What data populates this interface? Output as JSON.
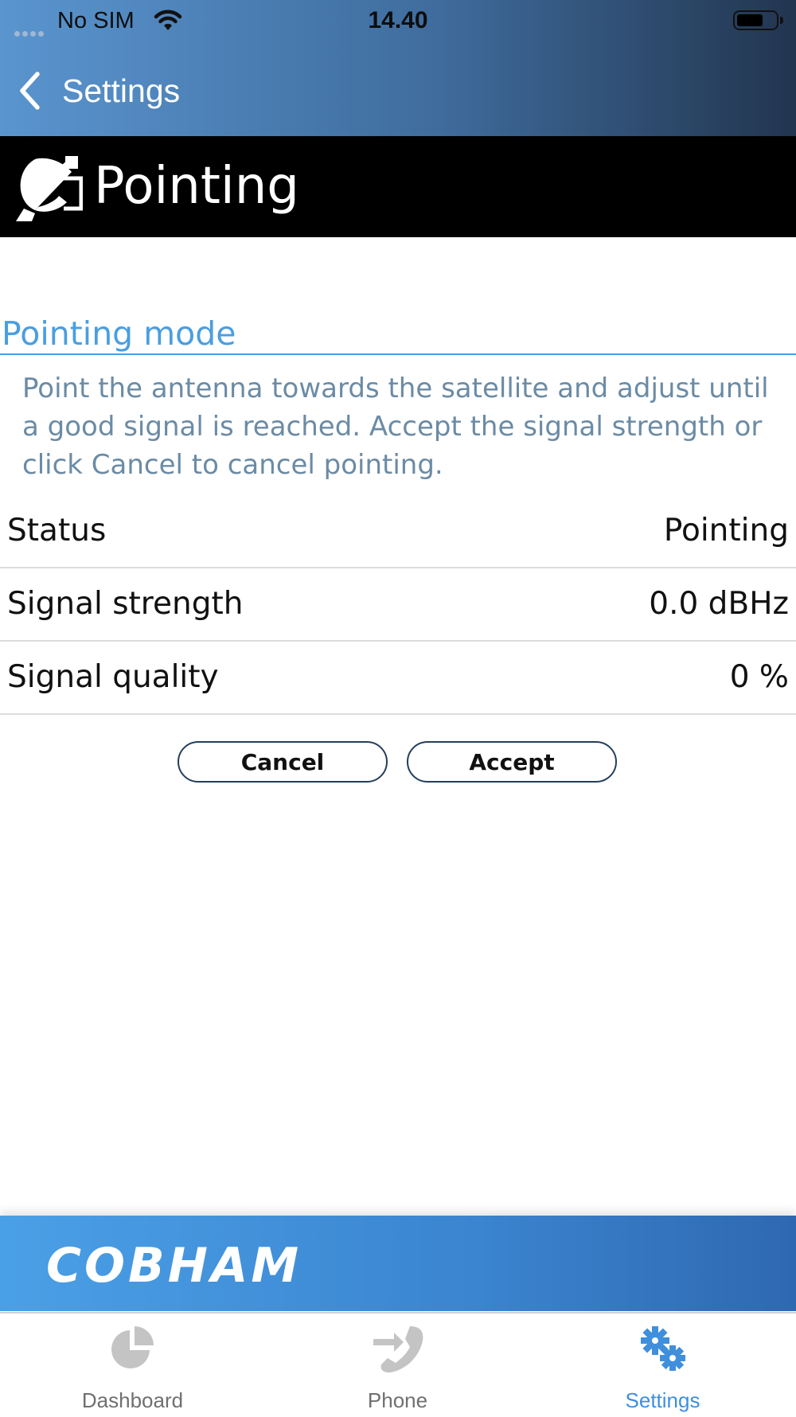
{
  "status_bar": {
    "carrier": "No SIM",
    "time": "14.40"
  },
  "nav": {
    "back_label": "Settings"
  },
  "page": {
    "title": "Pointing"
  },
  "section": {
    "title": "Pointing mode",
    "description": "Point the antenna towards the satellite and adjust until a good signal is reached. Accept the signal strength or click Cancel to cancel pointing."
  },
  "rows": [
    {
      "label": "Status",
      "value": "Pointing"
    },
    {
      "label": "Signal strength",
      "value": "0.0 dBHz"
    },
    {
      "label": "Signal quality",
      "value": "0 %"
    }
  ],
  "buttons": {
    "cancel": "Cancel",
    "accept": "Accept"
  },
  "brand": {
    "name": "COBHAM"
  },
  "tabs": [
    {
      "label": "Dashboard",
      "icon": "pie-chart-icon",
      "active": false
    },
    {
      "label": "Phone",
      "icon": "phone-transfer-icon",
      "active": false
    },
    {
      "label": "Settings",
      "icon": "gears-icon",
      "active": true
    }
  ],
  "colors": {
    "accent": "#4a9ee0",
    "header_start": "#5a95cf",
    "header_end": "#22354f",
    "tab_inactive": "#c4c4c4",
    "tab_active": "#3f8fdc",
    "description": "#6b8ba5"
  }
}
